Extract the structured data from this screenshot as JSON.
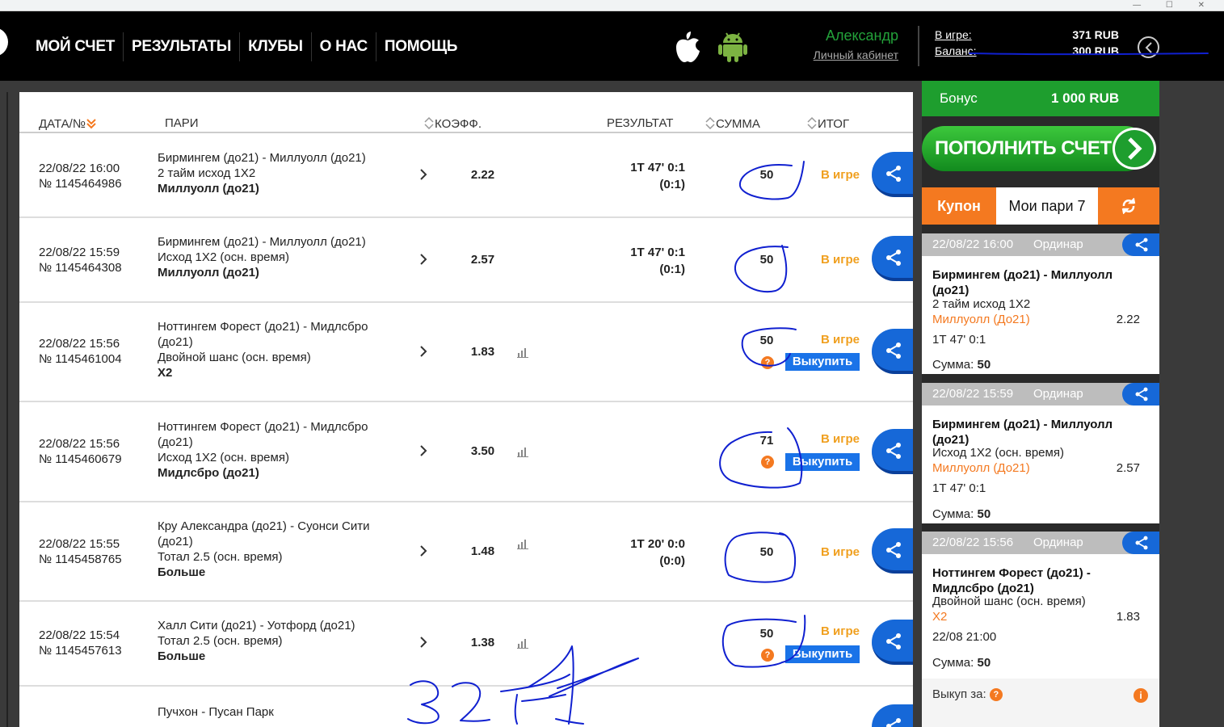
{
  "header": {
    "nav": [
      "МОЙ СЧЕТ",
      "РЕЗУЛЬТАТЫ",
      "КЛУБЫ",
      "О НАС",
      "ПОМОЩЬ"
    ],
    "user_name": "Александр",
    "cabinet_link": "Личный кабинет",
    "ingame_label": "В игре:",
    "ingame_value": "371 RUB",
    "balance_label": "Баланс:",
    "balance_value": "300 RUB"
  },
  "table": {
    "headers": {
      "date": "ДАТА/№",
      "pairs": "ПАРИ",
      "coef": "КОЭФФ.",
      "result": "РЕЗУЛЬТАТ",
      "sum": "СУММА",
      "outcome": "ИТОГ"
    },
    "rows": [
      {
        "date": "22/08/22 16:00",
        "number": "№ 1145464986",
        "event": "Бирмингем (до21) - Миллуолл (до21)",
        "market": "2 тайм исход 1X2",
        "pick": "Миллуолл (до21)",
        "coef": "2.22",
        "result1": "1Т 47' 0:1",
        "result2": "(0:1)",
        "amount": "50",
        "status": "В игре"
      },
      {
        "date": "22/08/22 15:59",
        "number": "№ 1145464308",
        "event": "Бирмингем (до21) - Миллуолл (до21)",
        "market": "Исход 1X2 (осн. время)",
        "pick": "Миллуолл (до21)",
        "coef": "2.57",
        "result1": "1Т 47' 0:1",
        "result2": "(0:1)",
        "amount": "50",
        "status": "В игре"
      },
      {
        "date": "22/08/22 15:56",
        "number": "№ 1145461004",
        "event": "Ноттингем Форест (до21) - Мидлсбро (до21)",
        "market": "Двойной шанс (осн. время)",
        "pick": "X2",
        "coef": "1.83",
        "result1": "",
        "result2": "",
        "amount": "50",
        "status": "В игре",
        "buyout": "Выкупить"
      },
      {
        "date": "22/08/22 15:56",
        "number": "№ 1145460679",
        "event": "Ноттингем Форест (до21) - Мидлсбро (до21)",
        "market": "Исход 1X2 (осн. время)",
        "pick": "Мидлсбро (до21)",
        "coef": "3.50",
        "result1": "",
        "result2": "",
        "amount": "71",
        "status": "В игре",
        "buyout": "Выкупить"
      },
      {
        "date": "22/08/22 15:55",
        "number": "№ 1145458765",
        "event": "Кру Александра (до21) - Суонси Сити (до21)",
        "market": "Тотал 2.5 (осн. время)",
        "pick": "Больше",
        "coef": "1.48",
        "result1": "1Т 20' 0:0",
        "result2": "(0:0)",
        "amount": "50",
        "status": "В игре"
      },
      {
        "date": "22/08/22 15:54",
        "number": "№ 1145457613",
        "event": "Халл Сити (до21) - Уотфорд (до21)",
        "market": "Тотал 2.5 (осн. время)",
        "pick": "Больше",
        "coef": "1.38",
        "result1": "",
        "result2": "",
        "amount": "50",
        "status": "В игре",
        "buyout": "Выкупить"
      },
      {
        "date": "",
        "number": "",
        "event": "Пучхон - Пусан Парк",
        "market": "",
        "pick": "",
        "coef": "",
        "result1": "",
        "result2": "",
        "amount": "",
        "status": ""
      }
    ]
  },
  "sidebar": {
    "bonus_label": "Бонус",
    "bonus_value": "1 000 RUB",
    "deposit_label": "ПОПОЛНИТЬ СЧЕТ",
    "tab_coupon": "Купон",
    "tab_mybets": "Мои пари 7",
    "sum_label": "Сумма:",
    "buyout_for": "Выкуп за:",
    "cards": [
      {
        "datetime": "22/08/22 16:00",
        "type": "Ординар",
        "event": "Бирмингем (до21) - Миллуолл (до21)",
        "market": "2 тайм исход 1X2",
        "pick": "Миллуолл (До21)",
        "coef": "2.22",
        "info": "1Т 47' 0:1",
        "sum": "50"
      },
      {
        "datetime": "22/08/22 15:59",
        "type": "Ординар",
        "event": "Бирмингем (до21) - Миллуолл (до21)",
        "market": "Исход 1X2 (осн. время)",
        "pick": "Миллуолл (До21)",
        "coef": "2.57",
        "info": "1Т 47' 0:1",
        "sum": "50"
      },
      {
        "datetime": "22/08/22 15:56",
        "type": "Ординар",
        "event": "Ноттингем Форест (до21) - Мидлсбро (до21)",
        "market": "Двойной шанс (осн. время)",
        "pick": "X2",
        "coef": "1.83",
        "info": "22/08 21:00",
        "sum": "50"
      }
    ]
  },
  "colors": {
    "accent_orange": "#f47920",
    "status_yellow": "#f0a020",
    "share_blue": "#1668d8",
    "brand_green": "#1e9e2e",
    "ink_blue": "#1020d0"
  }
}
